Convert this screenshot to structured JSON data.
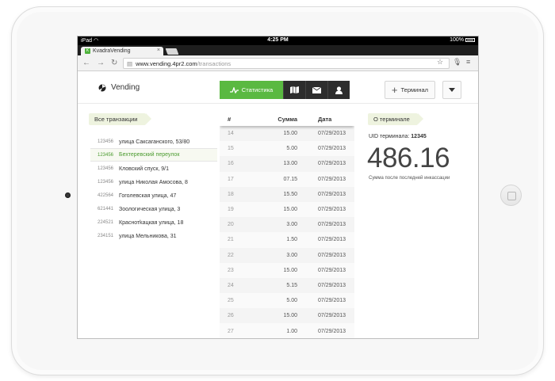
{
  "statusbar": {
    "device": "iPad",
    "time": "4:25 PM",
    "battery": "100%"
  },
  "browser": {
    "tab_title": "KvadraVending",
    "favicon_letter": "K",
    "url_host": "www.vending.4pr2.com",
    "url_path": "/transactions"
  },
  "header": {
    "logo_text": "Vending",
    "nav_active_label": "Статистика",
    "terminal_button_label": "Терминал"
  },
  "left": {
    "section_label": "Все транзакции",
    "items": [
      {
        "code": "123456",
        "address": "улица Саксаганского, 53/80",
        "active": false
      },
      {
        "code": "123456",
        "address": "Бехтеревский переулок",
        "active": true
      },
      {
        "code": "123456",
        "address": "Кловский спуск, 9/1",
        "active": false
      },
      {
        "code": "123456",
        "address": "улица Николая Амосова, 8",
        "active": false
      },
      {
        "code": "422564",
        "address": "Гоголевская улица, 47",
        "active": false
      },
      {
        "code": "621441",
        "address": "Зоологическая улица, 3",
        "active": false
      },
      {
        "code": "224521",
        "address": "Краснотkацкая улица, 18",
        "active": false
      },
      {
        "code": "234151",
        "address": "улица Мельникова, 31",
        "active": false
      }
    ]
  },
  "table": {
    "headers": {
      "num": "#",
      "sum": "Сумма",
      "date": "Дата"
    },
    "rows": [
      [
        "14",
        "15.00",
        "07/29/2013"
      ],
      [
        "15",
        "5.00",
        "07/29/2013"
      ],
      [
        "16",
        "13.00",
        "07/29/2013"
      ],
      [
        "17",
        "07.15",
        "07/29/2013"
      ],
      [
        "18",
        "15.50",
        "07/29/2013"
      ],
      [
        "19",
        "15.00",
        "07/29/2013"
      ],
      [
        "20",
        "3.00",
        "07/29/2013"
      ],
      [
        "21",
        "1.50",
        "07/29/2013"
      ],
      [
        "22",
        "3.00",
        "07/29/2013"
      ],
      [
        "23",
        "15.00",
        "07/29/2013"
      ],
      [
        "24",
        "5.15",
        "07/29/2013"
      ],
      [
        "25",
        "5.00",
        "07/29/2013"
      ],
      [
        "26",
        "15.00",
        "07/29/2013"
      ],
      [
        "27",
        "1.00",
        "07/29/2013"
      ]
    ]
  },
  "right": {
    "section_label": "О терминале",
    "uid_label": "UID терминала:",
    "uid_value": "12345",
    "amount": "486.16",
    "amount_caption": "Сумма после последней инкассации"
  },
  "colors": {
    "accent": "#5ab941",
    "nav_dark": "#2d2d2d",
    "active_text": "#4b9b2f"
  }
}
